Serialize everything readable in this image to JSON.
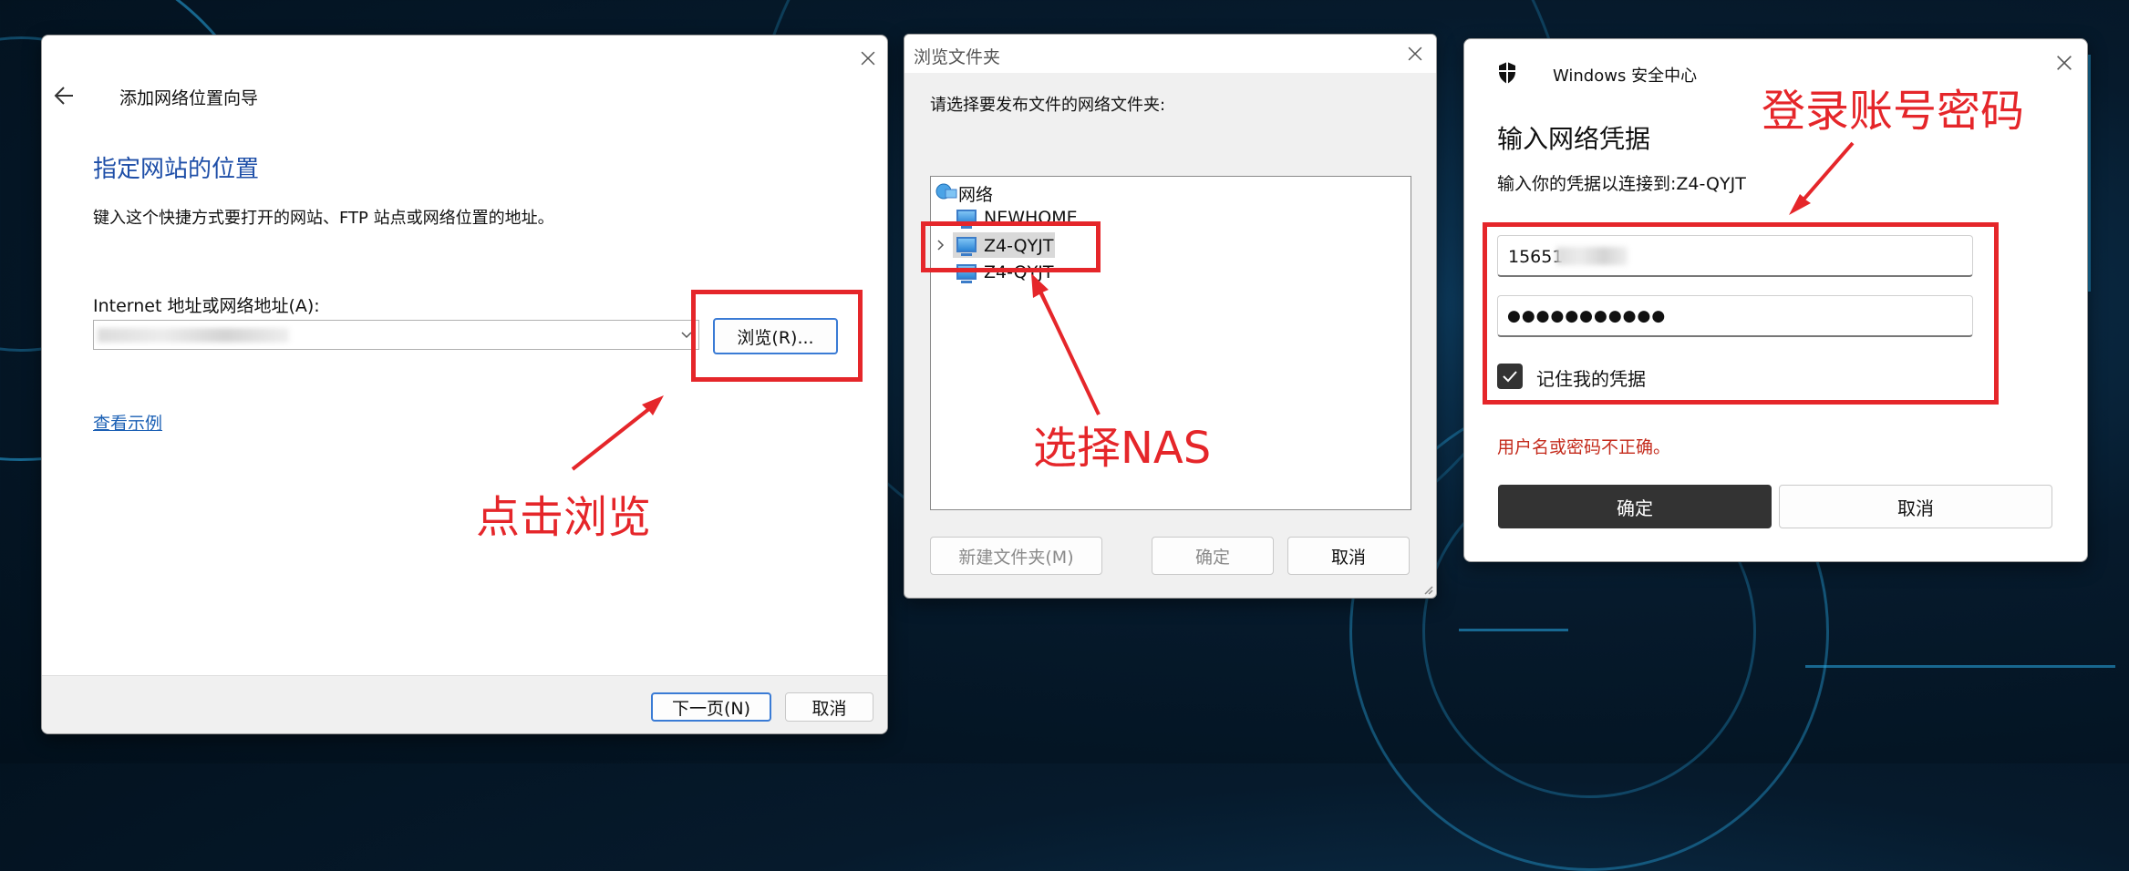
{
  "wizard": {
    "title": "添加网络位置向导",
    "heading": "指定网站的位置",
    "description": "键入这个快捷方式要打开的网站、FTP 站点或网络位置的地址。",
    "address_label": "Internet 地址或网络地址(A):",
    "browse_label": "浏览(R)...",
    "examples_link": "查看示例",
    "next_label": "下一页(N)",
    "cancel_label": "取消"
  },
  "browse": {
    "title": "浏览文件夹",
    "prompt": "请选择要发布文件的网络文件夹:",
    "tree": {
      "root": "网络",
      "items": [
        "NEWHOME",
        "Z4-QYJT",
        "Z4-QYJT"
      ]
    },
    "new_folder_label": "新建文件夹(M)",
    "ok_label": "确定",
    "cancel_label": "取消"
  },
  "security": {
    "app_title": "Windows 安全中心",
    "heading": "输入网络凭据",
    "subtitle": "输入你的凭据以连接到:Z4-QYJT",
    "username_value": "15651",
    "password_value": "●●●●●●●●●●●",
    "remember_label": "记住我的凭据",
    "error_text": "用户名或密码不正确。",
    "ok_label": "确定",
    "cancel_label": "取消"
  },
  "annotations": {
    "click_browse": "点击浏览",
    "select_nas": "选择NAS",
    "login": "登录账号密码"
  },
  "colors": {
    "annotation_red": "#e5262a",
    "link_blue": "#1a5fb4",
    "heading_blue": "#1f4fa8",
    "error_red": "#c42b1c",
    "primary_button": "#333333"
  }
}
